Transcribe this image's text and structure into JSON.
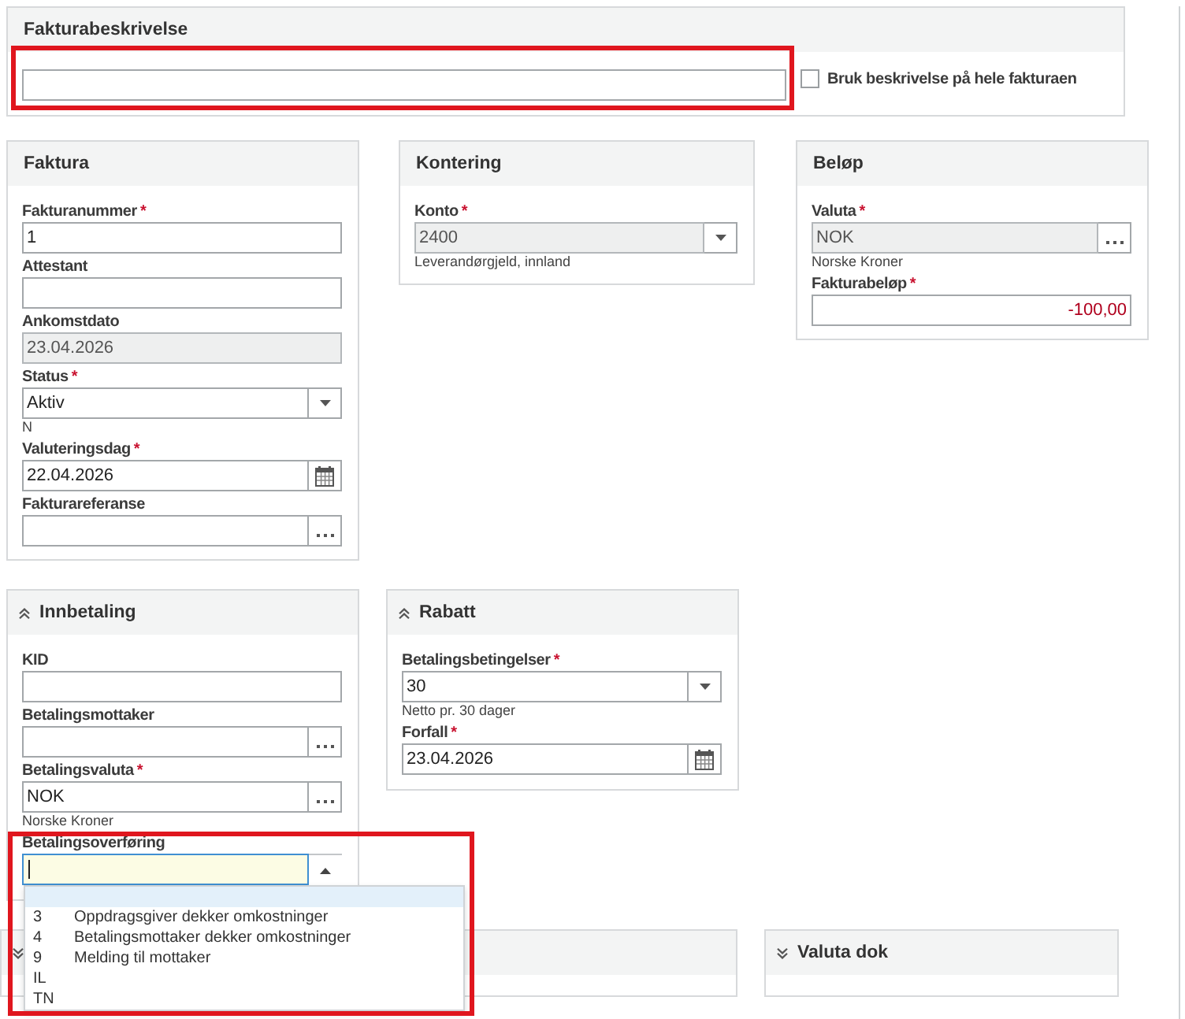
{
  "description_panel": {
    "title": "Fakturabeskrivelse",
    "field": {
      "kind": "text",
      "disabled": false,
      "focused": false,
      "highlighted": true
    },
    "checkbox": {
      "label": "Bruk beskrivelse på hele fakturaen",
      "checked": false
    }
  },
  "rows": [
    {
      "panels": [
        {
          "kind": "section",
          "title": "Faktura",
          "fields": [
            {
              "kind": "text",
              "label": "Fakturanummer",
              "required_mark": "*",
              "value": "1",
              "disabled": false,
              "focused": false,
              "highlighted": false
            },
            {
              "kind": "text",
              "label": "Attestant",
              "disabled": false,
              "focused": false,
              "highlighted": false
            },
            {
              "kind": "text",
              "label": "Ankomstdato",
              "value": "23.04.2026",
              "disabled": true,
              "focused": false,
              "highlighted": false
            },
            {
              "kind": "select",
              "label": "Status",
              "required_mark": "*",
              "value": "Aktiv",
              "hint": "N",
              "disabled": false,
              "focused": false,
              "highlighted": false
            },
            {
              "kind": "date",
              "label": "Valuteringsdag",
              "required_mark": "*",
              "value": "22.04.2026",
              "disabled": false,
              "focused": false,
              "highlighted": false
            },
            {
              "kind": "lookup",
              "label": "Fakturareferanse",
              "disabled": false,
              "focused": false,
              "highlighted": false
            }
          ]
        },
        {
          "kind": "section",
          "title": "Kontering",
          "fields": [
            {
              "kind": "select",
              "label": "Konto",
              "required_mark": "*",
              "value": "2400",
              "hint": "Leverandørgjeld, innland",
              "disabled": true,
              "focused": false,
              "highlighted": false
            }
          ]
        },
        {
          "kind": "section",
          "title": "Beløp",
          "fields": [
            {
              "kind": "lookup",
              "label": "Valuta",
              "required_mark": "*",
              "value": "NOK",
              "hint": "Norske Kroner",
              "disabled": true,
              "focused": false,
              "highlighted": false
            },
            {
              "kind": "amount",
              "label": "Fakturabeløp",
              "required_mark": "*",
              "value": "-100,00",
              "disabled": false,
              "focused": false,
              "highlighted": false
            }
          ]
        }
      ]
    },
    {
      "panels": [
        {
          "kind": "collapsible",
          "expanded": true,
          "title": "Innbetaling",
          "fields": [
            {
              "kind": "text",
              "label": "KID",
              "disabled": false,
              "focused": false,
              "highlighted": false
            },
            {
              "kind": "lookup",
              "label": "Betalingsmottaker",
              "disabled": false,
              "focused": false,
              "highlighted": false
            },
            {
              "kind": "lookup",
              "label": "Betalingsvaluta",
              "required_mark": "*",
              "value": "NOK",
              "hint": "Norske Kroner",
              "disabled": false,
              "focused": false,
              "highlighted": false
            },
            {
              "kind": "combo",
              "label": "Betalingsoverføring",
              "disabled": false,
              "focused": true,
              "highlighted": true,
              "expanded": true,
              "options": [
                {
                  "selected": true
                },
                {
                  "code": "3",
                  "text": "Oppdragsgiver dekker omkostninger",
                  "selected": false
                },
                {
                  "code": "4",
                  "text": "Betalingsmottaker dekker omkostninger",
                  "selected": false
                },
                {
                  "code": "9",
                  "text": "Melding til mottaker",
                  "selected": false
                },
                {
                  "code": "IL",
                  "selected": false
                },
                {
                  "code": "TN",
                  "selected": false
                }
              ]
            }
          ]
        },
        {
          "kind": "collapsible",
          "expanded": true,
          "title": "Rabatt",
          "fields": [
            {
              "kind": "select",
              "label": "Betalingsbetingelser",
              "required_mark": "*",
              "value": "30",
              "hint": "Netto pr. 30 dager",
              "disabled": false,
              "focused": false,
              "highlighted": false
            },
            {
              "kind": "date",
              "label": "Forfall",
              "required_mark": "*",
              "value": "23.04.2026",
              "disabled": false,
              "focused": false,
              "highlighted": false
            }
          ]
        }
      ]
    },
    {
      "panels": [
        {
          "kind": "collapsible",
          "expanded": false
        },
        {
          "kind": "collapsible",
          "expanded": false,
          "title": "Valuta dok"
        }
      ]
    }
  ]
}
